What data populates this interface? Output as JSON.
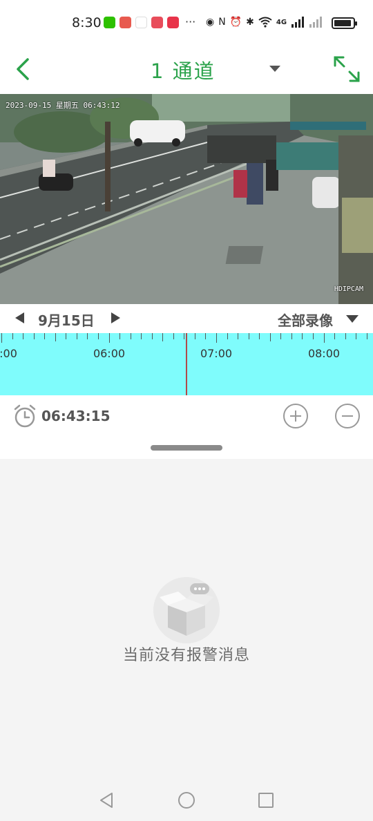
{
  "status_bar": {
    "time": "8:30",
    "more": "···",
    "network": "4G",
    "app_icon_colors": [
      "#2dc100",
      "#e85a4f",
      "#1b1b1b",
      "#e84d5b",
      "#e8344a"
    ]
  },
  "header": {
    "title": "1 通道",
    "back_icon": "chevron-left-icon",
    "fullscreen_icon": "fullscreen-icon",
    "accent_color": "#2aa24a"
  },
  "video": {
    "timestamp": "2023-09-15 星期五 06:43:12",
    "camera_label": "HDIPCAM"
  },
  "date_bar": {
    "date": "9月15日",
    "filter": "全部录像"
  },
  "timeline": {
    "labels": [
      ":00",
      "06:00",
      "07:00",
      "08:00"
    ],
    "fill_color": "#7ffcfc"
  },
  "controls": {
    "current_time": "06:43:15",
    "clock_icon": "alarm-clock-icon",
    "zoom_in_icon": "plus-circle-icon",
    "zoom_out_icon": "minus-circle-icon"
  },
  "empty_state": {
    "message": "当前没有报警消息",
    "icon": "empty-box-icon"
  },
  "nav_bar": {
    "back": "triangle-back-icon",
    "home": "circle-home-icon",
    "recent": "square-recent-icon"
  }
}
